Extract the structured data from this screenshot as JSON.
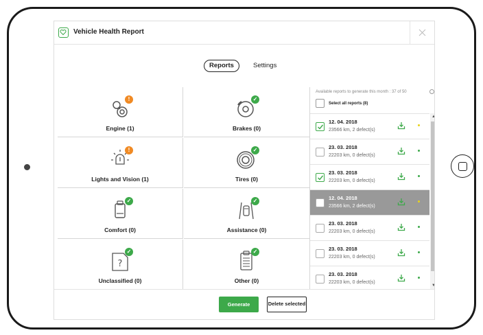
{
  "window": {
    "title": "Vehicle Health Report"
  },
  "tabs": [
    {
      "label": "Reports"
    },
    {
      "label": "Settings"
    }
  ],
  "categories": [
    {
      "label": "Engine (1)",
      "icon": "engine-icon",
      "status": "warning",
      "badge": "!"
    },
    {
      "label": "Brakes (0)",
      "icon": "brake-disc-icon",
      "status": "ok",
      "badge": "✓"
    },
    {
      "label": "Lights and Vision (1)",
      "icon": "lights-icon",
      "status": "warning",
      "badge": "!"
    },
    {
      "label": "Tires (0)",
      "icon": "tire-icon",
      "status": "ok",
      "badge": "✓"
    },
    {
      "label": "Comfort (0)",
      "icon": "seat-icon",
      "status": "ok",
      "badge": "✓"
    },
    {
      "label": "Assistance (0)",
      "icon": "lane-assist-icon",
      "status": "ok",
      "badge": "✓"
    },
    {
      "label": "Unclassified (0)",
      "icon": "unknown-icon",
      "status": "ok",
      "badge": "✓"
    },
    {
      "label": "Other (0)",
      "icon": "clipboard-icon",
      "status": "ok",
      "badge": "✓"
    }
  ],
  "reports_panel": {
    "available_text": "Available reports to generate this month : 37 of 50",
    "select_all_label": "Select all reports (8)",
    "items": [
      {
        "date": "12. 04. 2018",
        "detail": "23566 km, 2 defect(s)",
        "checked": true,
        "dot_color": "#e8d21a",
        "highlighted": false
      },
      {
        "date": "23. 03. 2018",
        "detail": "22203 km, 0 defect(s)",
        "checked": false,
        "dot_color": "#3da94a",
        "highlighted": false
      },
      {
        "date": "23. 03. 2018",
        "detail": "22203 km, 0 defect(s)",
        "checked": true,
        "dot_color": "#3da94a",
        "highlighted": false
      },
      {
        "date": "12. 04. 2018",
        "detail": "23566 km, 2 defect(s)",
        "checked": false,
        "dot_color": "#e8d21a",
        "highlighted": true
      },
      {
        "date": "23. 03. 2018",
        "detail": "22203 km, 0 defect(s)",
        "checked": false,
        "dot_color": "#3da94a",
        "highlighted": false
      },
      {
        "date": "23. 03. 2018",
        "detail": "22203 km, 0 defect(s)",
        "checked": false,
        "dot_color": "#3da94a",
        "highlighted": false
      },
      {
        "date": "23. 03. 2018",
        "detail": "22203 km, 0 defect(s)",
        "checked": false,
        "dot_color": "#3da94a",
        "highlighted": false
      }
    ]
  },
  "footer": {
    "generate_label": "Generate",
    "delete_label": "Delete selected"
  },
  "colors": {
    "accent": "#3da94a",
    "warning": "#f08a24",
    "highlight_row": "#999999"
  }
}
